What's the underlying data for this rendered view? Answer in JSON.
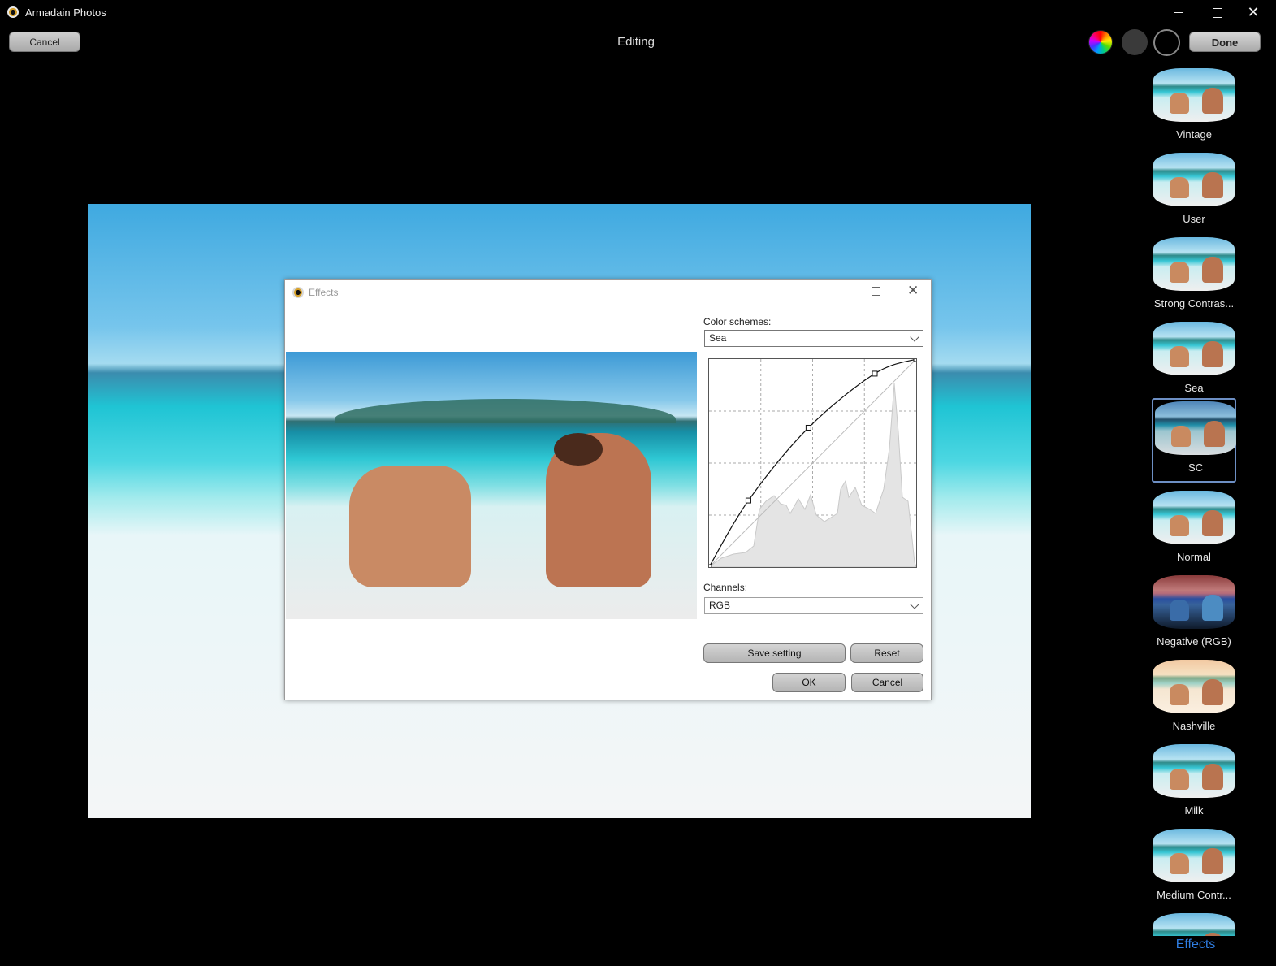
{
  "window": {
    "title": "Armadain Photos",
    "close_glyph": "✕"
  },
  "toolbar": {
    "cancel_label": "Cancel",
    "title": "Editing",
    "done_label": "Done",
    "icons": [
      "color-wheel-icon",
      "gray-circle-icon",
      "black-circle-icon"
    ]
  },
  "effects": {
    "items": [
      {
        "label": "Vintage",
        "selected": false
      },
      {
        "label": "User",
        "selected": false
      },
      {
        "label": "Strong Contras...",
        "selected": false
      },
      {
        "label": "Sea",
        "selected": false
      },
      {
        "label": "SC",
        "selected": true
      },
      {
        "label": "Normal",
        "selected": false
      },
      {
        "label": "Negative (RGB)",
        "selected": false
      },
      {
        "label": "Nashville",
        "selected": false
      },
      {
        "label": "Milk",
        "selected": false
      },
      {
        "label": "Medium Contr...",
        "selected": false
      }
    ],
    "link_label": "Effects",
    "link_color": "#2f7de1",
    "selected_border_color": "#6d8fc4"
  },
  "dialog": {
    "title": "Effects",
    "close_glyph": "✕",
    "color_schemes_label": "Color schemes:",
    "color_scheme_value": "Sea",
    "channels_label": "Channels:",
    "channel_value": "RGB",
    "save_label": "Save setting",
    "reset_label": "Reset",
    "ok_label": "OK",
    "cancel_label": "Cancel",
    "curve": {
      "control_points": [
        [
          0,
          0
        ],
        [
          0.19,
          0.32
        ],
        [
          0.48,
          0.67
        ],
        [
          0.8,
          0.93
        ],
        [
          1,
          1
        ]
      ],
      "grid_divisions": 4
    }
  }
}
